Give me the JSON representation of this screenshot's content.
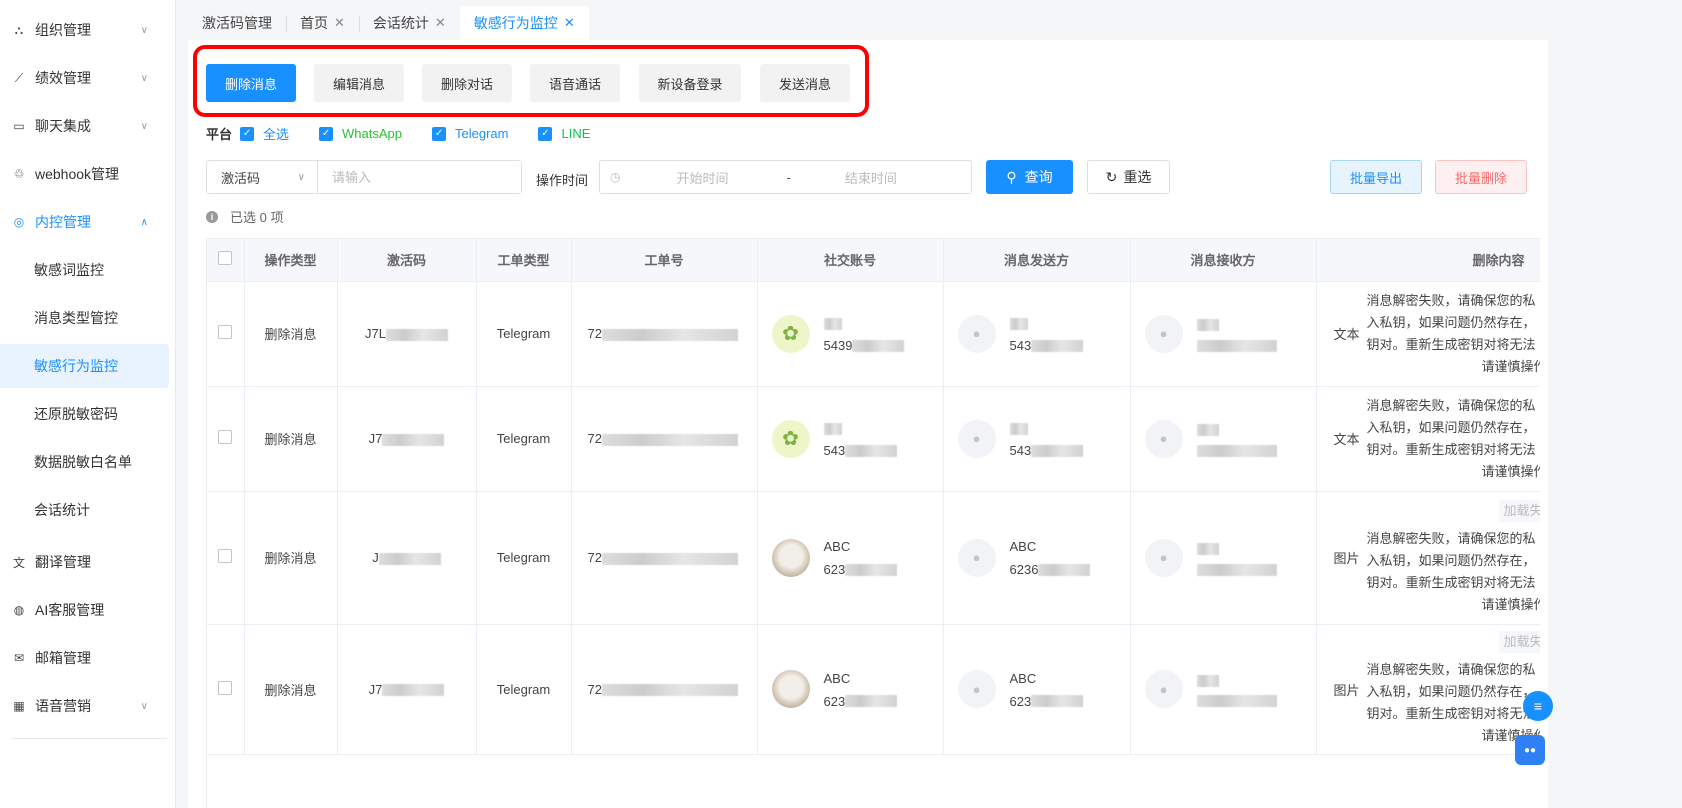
{
  "sidebar": {
    "items": [
      {
        "label": "组织管理",
        "icon": "org-icon",
        "chev": "∨"
      },
      {
        "label": "绩效管理",
        "icon": "chart-icon",
        "chev": "∨"
      },
      {
        "label": "聊天集成",
        "icon": "chat-icon",
        "chev": "∨"
      },
      {
        "label": "webhook管理",
        "icon": "webhook-icon",
        "chev": ""
      },
      {
        "label": "内控管理",
        "icon": "location-icon",
        "chev": "∧",
        "open": true
      },
      {
        "label": "翻译管理",
        "icon": "translate-icon",
        "chev": ""
      },
      {
        "label": "AI客服管理",
        "icon": "ai-icon",
        "chev": ""
      },
      {
        "label": "邮箱管理",
        "icon": "mail-icon",
        "chev": ""
      },
      {
        "label": "语音营销",
        "icon": "voice-icon",
        "chev": "∨"
      }
    ],
    "sub_items": [
      "敏感词监控",
      "消息类型管控",
      "敏感行为监控",
      "还原脱敏密码",
      "数据脱敏白名单",
      "会话统计"
    ]
  },
  "tabs": [
    {
      "label": "激活码管理",
      "closable": false
    },
    {
      "label": "首页",
      "closable": true
    },
    {
      "label": "会话统计",
      "closable": true
    },
    {
      "label": "敏感行为监控",
      "closable": true,
      "active": true
    }
  ],
  "op_types": [
    "删除消息",
    "编辑消息",
    "删除对话",
    "语音通话",
    "新设备登录",
    "发送消息"
  ],
  "platform": {
    "label": "平台",
    "options": [
      {
        "label": "全选",
        "color": "#1890ff"
      },
      {
        "label": "WhatsApp",
        "color": "#25c12f"
      },
      {
        "label": "Telegram",
        "color": "#1890ff"
      },
      {
        "label": "LINE",
        "color": "#06c755"
      }
    ]
  },
  "filter": {
    "select_value": "激活码",
    "input_placeholder": "请输入",
    "time_label": "操作时间",
    "start_placeholder": "开始时间",
    "end_placeholder": "结束时间",
    "range_sep": "-",
    "query": "查询",
    "reset": "重选",
    "export": "批量导出",
    "batch_delete": "批量删除"
  },
  "selected_info": "已选 0 项",
  "table": {
    "headers": [
      "操作类型",
      "激活码",
      "工单类型",
      "工单号",
      "社交账号",
      "消息发送方",
      "消息接收方",
      "删除内容"
    ],
    "rows": [
      {
        "op": "删除消息",
        "code": "J7L",
        "type": "Telegram",
        "order": "72",
        "acct_name": "",
        "acct_id": "5439",
        "acct_av": "clover",
        "sender_name": "",
        "sender_id": "543",
        "receiver_name": "",
        "receiver_id": "",
        "ctype": "文本",
        "load_fail": ""
      },
      {
        "op": "删除消息",
        "code": "J7",
        "type": "Telegram",
        "order": "72",
        "acct_name": "",
        "acct_id": "543",
        "acct_av": "clover",
        "sender_name": "",
        "sender_id": "543",
        "receiver_name": "",
        "receiver_id": "",
        "ctype": "文本",
        "load_fail": ""
      },
      {
        "op": "删除消息",
        "code": "J",
        "type": "Telegram",
        "order": "72",
        "acct_name": "ABC",
        "acct_id": "623",
        "acct_av": "dog",
        "sender_name": "ABC",
        "sender_id": "6236",
        "receiver_name": "",
        "receiver_id": "",
        "ctype": "图片",
        "load_fail": "加载失"
      },
      {
        "op": "删除消息",
        "code": "J7",
        "type": "Telegram",
        "order": "72",
        "acct_name": "ABC",
        "acct_id": "623",
        "acct_av": "dog",
        "sender_name": "ABC",
        "sender_id": "623",
        "receiver_name": "",
        "receiver_id": "",
        "ctype": "图片",
        "load_fail": "加载失"
      }
    ],
    "content_lines": [
      "消息解密失败，请确保您的私",
      "入私钥，如果问题仍然存在，",
      "钥对。重新生成密钥对将无法",
      "请谨慎操作"
    ]
  }
}
